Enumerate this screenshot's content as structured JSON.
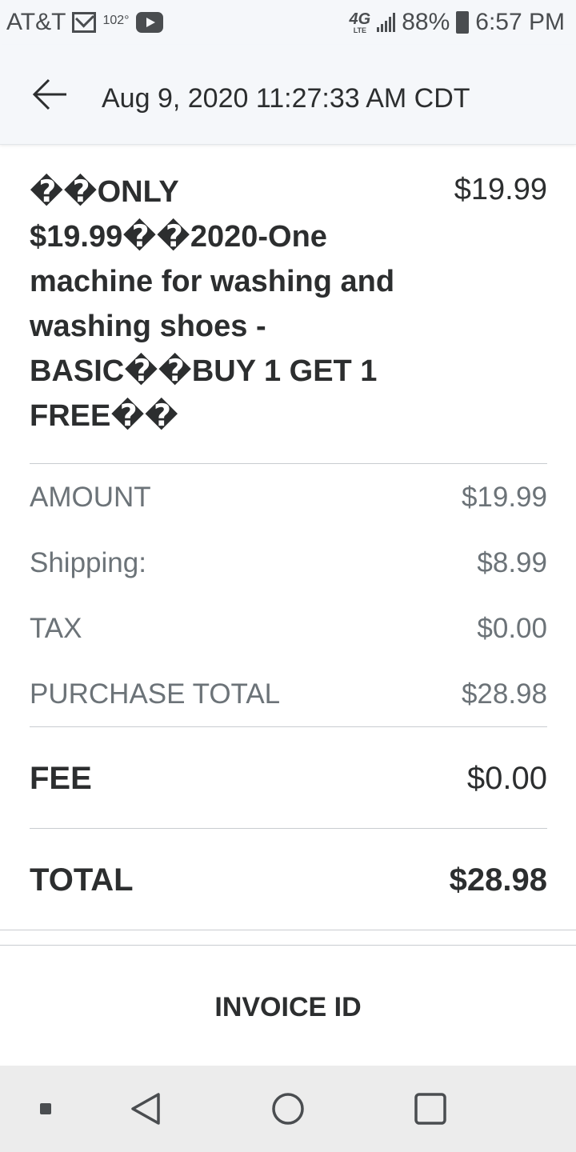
{
  "status_bar": {
    "carrier": "AT&T",
    "temperature": "102°",
    "network": "4G",
    "network_sub": "LTE",
    "battery": "88%",
    "time": "6:57 PM",
    "icons": [
      "mail-icon",
      "youtube-icon",
      "signal-icon",
      "battery-icon"
    ]
  },
  "header": {
    "back_icon": "arrow-left-icon",
    "title": "Aug 9, 2020 11:27:33 AM CDT"
  },
  "item": {
    "title": "��ONLY $19.99��2020-One machine for washing and washing shoes - BASIC��BUY 1 GET 1 FREE��",
    "price": "$19.99"
  },
  "summary": [
    {
      "label": "AMOUNT",
      "value": "$19.99"
    },
    {
      "label": "Shipping:",
      "value": "$8.99"
    },
    {
      "label": "TAX",
      "value": "$0.00"
    },
    {
      "label": "PURCHASE TOTAL",
      "value": "$28.98"
    }
  ],
  "fee": {
    "label": "FEE",
    "value": "$0.00"
  },
  "total": {
    "label": "TOTAL",
    "value": "$28.98"
  },
  "invoice": {
    "label": "INVOICE ID"
  },
  "nav_bar": {
    "icons": [
      "dot-icon",
      "back-triangle-icon",
      "home-circle-icon",
      "recents-square-icon"
    ]
  },
  "colors": {
    "text_primary": "#2c2e2f",
    "text_secondary": "#6c7378",
    "header_bg": "#f5f7fa",
    "nav_bg": "#ececec",
    "divider": "#c9ccd0"
  }
}
